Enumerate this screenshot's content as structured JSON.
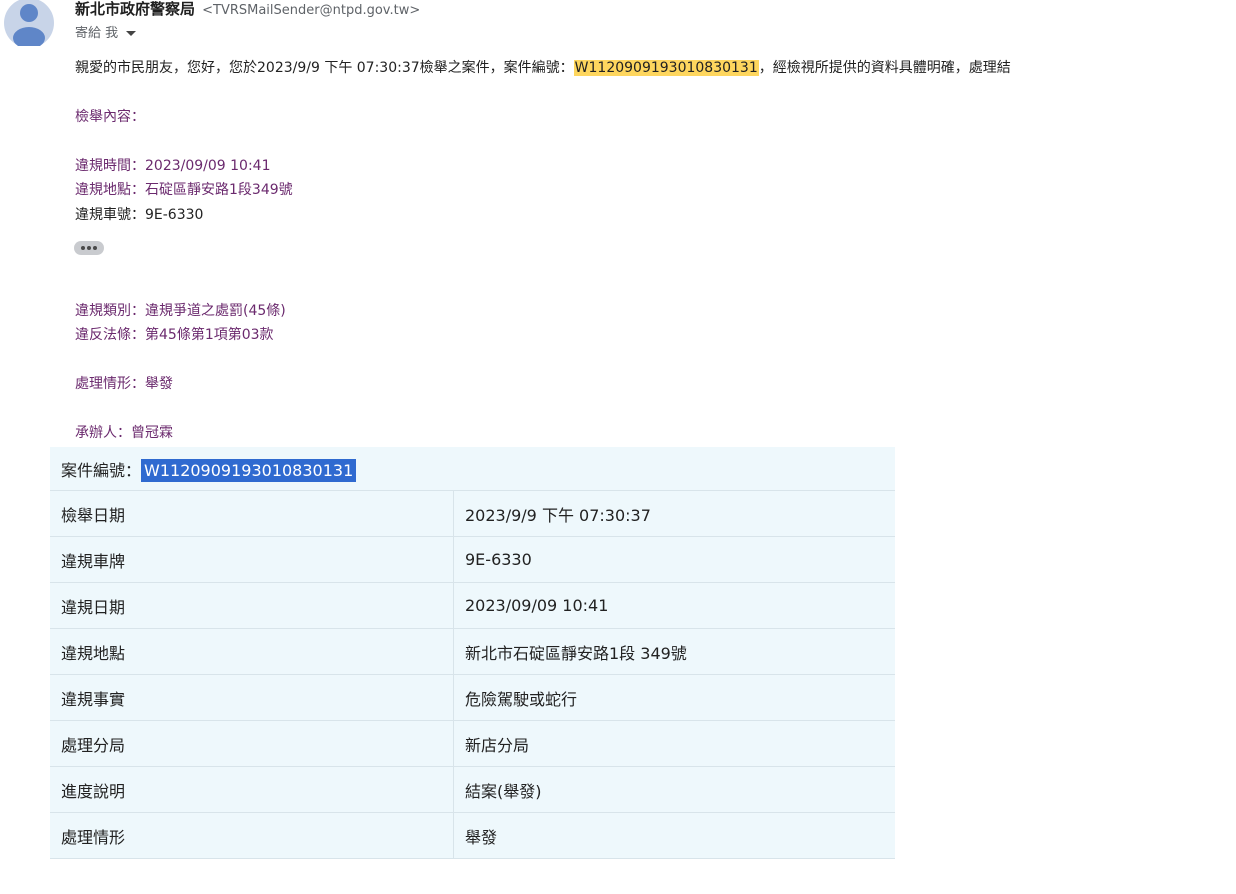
{
  "email": {
    "sender_name": "新北市政府警察局",
    "sender_email": "<TVRSMailSender@ntpd.gov.tw>",
    "to_label": "寄給 我",
    "intro_before": "親愛的市民朋友，您好，您於2023/9/9 下午 07:30:37檢舉之案件，案件編號：",
    "intro_case_no": "W1120909193010830131",
    "intro_after": "，經檢視所提供的資料具體明確，處理結",
    "report_heading": "檢舉內容：",
    "violation_time": "違規時間：2023/09/09 10:41",
    "violation_place": "違規地點：石碇區靜安路1段349號",
    "violation_plate": "違規車號：9E-6330",
    "violation_category": "違規類別：違規爭道之處罰(45條)",
    "violated_law": "違反法條：第45條第1項第03款",
    "handling_status": "處理情形：舉發",
    "handler": "承辦人：曾冠霖"
  },
  "table": {
    "case_label": "案件編號：",
    "case_no": "W1120909193010830131",
    "rows": [
      {
        "label": "檢舉日期",
        "value": "2023/9/9 下午 07:30:37"
      },
      {
        "label": "違規車牌",
        "value": "9E-6330"
      },
      {
        "label": "違規日期",
        "value": "2023/09/09 10:41"
      },
      {
        "label": "違規地點",
        "value": "新北市石碇區靜安路1段 349號"
      },
      {
        "label": "違規事實",
        "value": "危險駕駛或蛇行"
      },
      {
        "label": "處理分局",
        "value": "新店分局"
      },
      {
        "label": "進度說明",
        "value": "結案(舉發)"
      },
      {
        "label": "處理情形",
        "value": "舉發"
      }
    ]
  },
  "colors": {
    "highlight": "#fed65e",
    "selection": "#2f6ad0",
    "table_bg": "#eef8fc",
    "purple_text": "#6b2a6e"
  }
}
